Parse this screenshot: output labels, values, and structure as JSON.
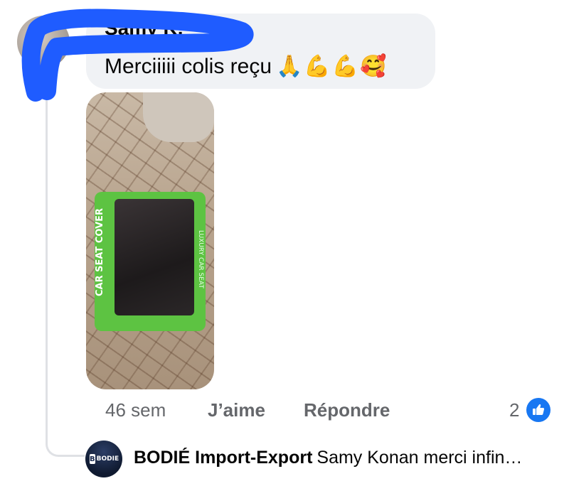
{
  "comment": {
    "author": "Samy K.",
    "text": "Merciiiii colis reçu",
    "emojis": "🙏💪💪🥰",
    "photo": {
      "bag_label": "CAR SEAT COVER",
      "bag_side_label": "LUXURY CAR SEAT"
    },
    "time": "46 sem",
    "like_label": "J’aime",
    "reply_label": "Répondre",
    "reaction_count": "2",
    "reaction_icon": "thumbs-up-icon"
  },
  "reply": {
    "author": "BODIÉ Import-Export",
    "text": "Samy Konan merci infin…",
    "avatar_logo": "BODIE"
  },
  "colors": {
    "bubble": "#f0f2f5",
    "meta_text": "#65676b",
    "like_blue": "#1877f2",
    "scribble": "#1f5cff",
    "bag_green": "#5dc342"
  }
}
